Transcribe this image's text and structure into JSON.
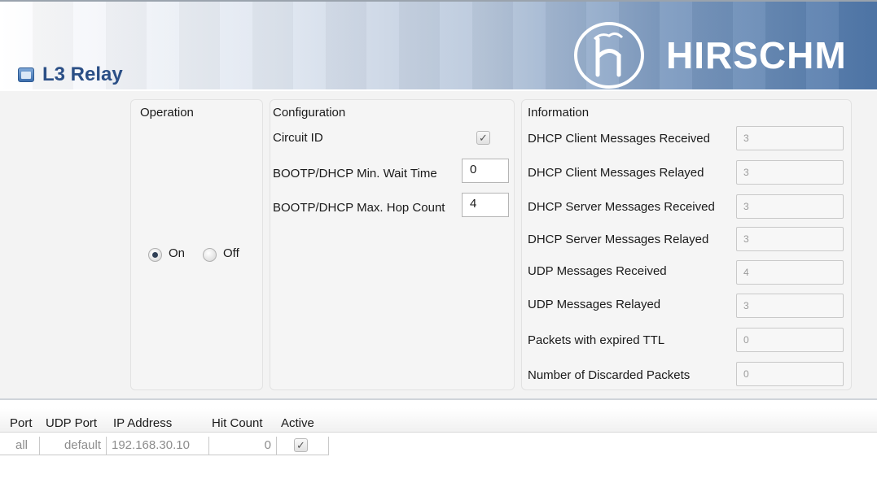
{
  "header": {
    "title": "L3 Relay",
    "brand": "HIRSCHM"
  },
  "operation": {
    "title": "Operation",
    "on_label": "On",
    "off_label": "Off",
    "selected": "On"
  },
  "configuration": {
    "title": "Configuration",
    "circuit_id_label": "Circuit ID",
    "circuit_id_checked": "✓",
    "min_wait_label": "BOOTP/DHCP Min. Wait Time",
    "min_wait_value": "0",
    "max_hop_label": "BOOTP/DHCP Max. Hop Count",
    "max_hop_value": "4"
  },
  "information": {
    "title": "Information",
    "rows": [
      {
        "label": "DHCP Client Messages Received",
        "value": "3"
      },
      {
        "label": "DHCP Client Messages Relayed",
        "value": "3"
      },
      {
        "label": "DHCP Server Messages Received",
        "value": "3"
      },
      {
        "label": "DHCP Server Messages Relayed",
        "value": "3"
      },
      {
        "label": "UDP Messages Received",
        "value": "4"
      },
      {
        "label": "UDP Messages Relayed",
        "value": "3"
      },
      {
        "label": "Packets with expired TTL",
        "value": "0"
      },
      {
        "label": "Number of Discarded Packets",
        "value": "0"
      }
    ]
  },
  "table": {
    "columns": [
      "Port",
      "UDP Port",
      "IP Address",
      "Hit Count",
      "Active"
    ],
    "rows": [
      {
        "port": "all",
        "udp_port": "default",
        "ip": "192.168.30.10",
        "hit_count": "0",
        "active": "✓"
      }
    ]
  },
  "colors": {
    "title": "#2b4f86",
    "banner_end": "#4f77a9"
  },
  "icons": {
    "title": "window-icon",
    "logo": "hirschmann-logo"
  }
}
